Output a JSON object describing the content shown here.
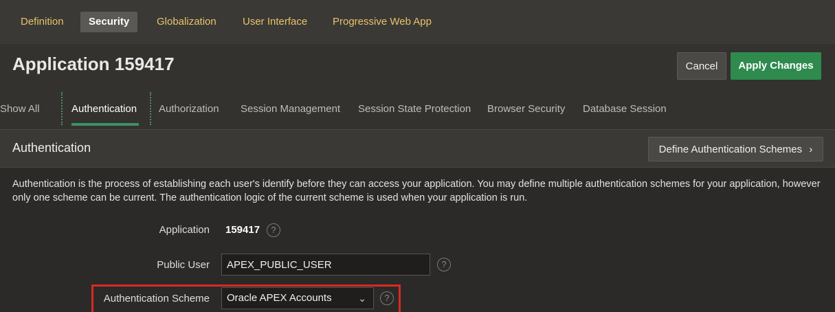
{
  "top_tabs": [
    {
      "label": "Definition",
      "active": false
    },
    {
      "label": "Security",
      "active": true
    },
    {
      "label": "Globalization",
      "active": false
    },
    {
      "label": "User Interface",
      "active": false
    },
    {
      "label": "Progressive Web App",
      "active": false
    }
  ],
  "header": {
    "title": "Application 159417",
    "cancel_label": "Cancel",
    "apply_label": "Apply Changes"
  },
  "sub_tabs": [
    {
      "label": "Show All"
    },
    {
      "label": "Authentication",
      "active": true
    },
    {
      "label": "Authorization"
    },
    {
      "label": "Session Management"
    },
    {
      "label": "Session State Protection"
    },
    {
      "label": "Browser Security"
    },
    {
      "label": "Database Session"
    }
  ],
  "section": {
    "title": "Authentication",
    "define_button": "Define Authentication Schemes",
    "define_icon": "chevron-right-icon",
    "description": "Authentication is the process of establishing each user's identify before they can access your application. You may define multiple authentication schemes for your application, however only one scheme can be current. The authentication logic of the current scheme is used when your application is run."
  },
  "form": {
    "application_label": "Application",
    "application_value": "159417",
    "public_user_label": "Public User",
    "public_user_value": "APEX_PUBLIC_USER",
    "auth_scheme_label": "Authentication Scheme",
    "auth_scheme_value": "Oracle APEX Accounts",
    "help_glyph": "?"
  },
  "colors": {
    "accent_yellow": "#e8c468",
    "apply_green": "#2f8a4e",
    "highlight_red": "#d92a22",
    "tab_underline": "#3f8f63"
  }
}
